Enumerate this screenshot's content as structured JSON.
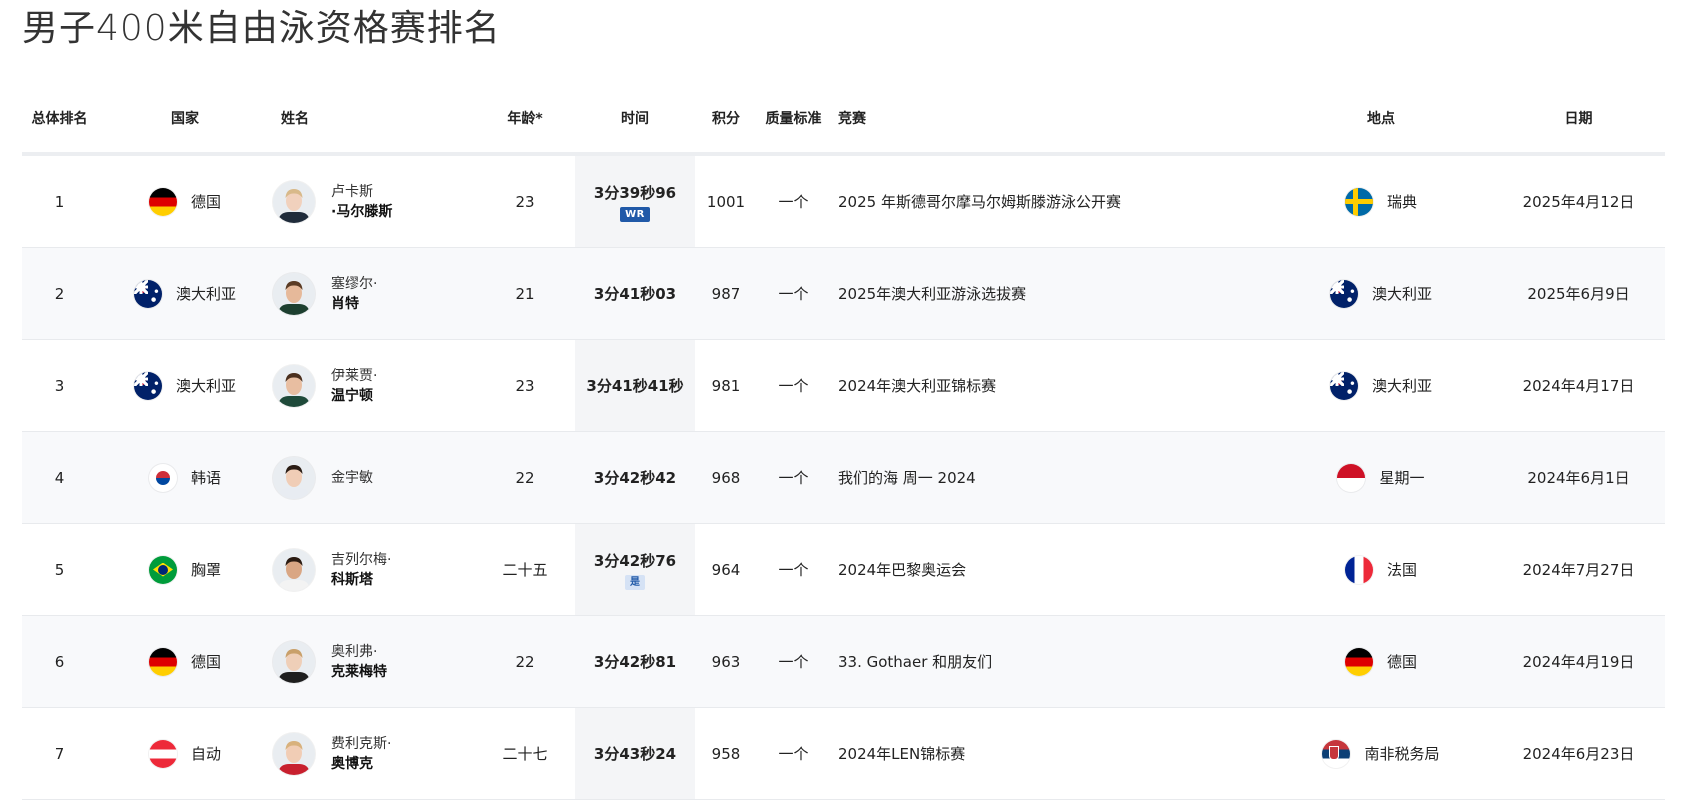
{
  "page_title": "男子400米自由泳资格赛排名",
  "columns": {
    "rank": "总体排名",
    "country": "国家",
    "name": "姓名",
    "age": "年龄*",
    "time": "时间",
    "points": "积分",
    "standard": "质量标准",
    "competition": "竞赛",
    "venue": "地点",
    "date": "日期"
  },
  "rows": [
    {
      "rank": "1",
      "country": "德国",
      "flag": "germany-flag-icon",
      "first_name": "卢卡斯",
      "last_name": "·马尔滕斯",
      "age": "23",
      "time": "3分39秒96",
      "badge": "WR",
      "points": "1001",
      "standard": "一个",
      "competition": "2025 年斯德哥尔摩马尔姆斯滕游泳公开赛",
      "venue": "瑞典",
      "venue_flag": "sweden-flag-icon",
      "date": "2025年4月12日"
    },
    {
      "rank": "2",
      "country": "澳大利亚",
      "flag": "australia-flag-icon",
      "first_name": "塞缪尔·",
      "last_name": "肖特",
      "age": "21",
      "time": "3分41秒03",
      "badge": "",
      "points": "987",
      "standard": "一个",
      "competition": "2025年澳大利亚游泳选拔赛",
      "venue": "澳大利亚",
      "venue_flag": "australia-flag-icon",
      "date": "2025年6月9日"
    },
    {
      "rank": "3",
      "country": "澳大利亚",
      "flag": "australia-flag-icon",
      "first_name": "伊莱贾·",
      "last_name": "温宁顿",
      "age": "23",
      "time": "3分41秒41秒",
      "badge": "",
      "points": "981",
      "standard": "一个",
      "competition": "2024年澳大利亚锦标赛",
      "venue": "澳大利亚",
      "venue_flag": "australia-flag-icon",
      "date": "2024年4月17日"
    },
    {
      "rank": "4",
      "country": "韩语",
      "flag": "korea-flag-icon",
      "first_name": "金宇敏",
      "last_name": "",
      "age": "22",
      "time": "3分42秒42",
      "badge": "",
      "points": "968",
      "standard": "一个",
      "competition": "我们的海 周一 2024",
      "venue": "星期一",
      "venue_flag": "indonesia-flag-icon",
      "date": "2024年6月1日"
    },
    {
      "rank": "5",
      "country": "胸罩",
      "flag": "brazil-flag-icon",
      "first_name": "吉列尔梅·",
      "last_name": "科斯塔",
      "age": "二十五",
      "time": "3分42秒76",
      "badge": "是",
      "points": "964",
      "standard": "一个",
      "competition": "2024年巴黎奥运会",
      "venue": "法国",
      "venue_flag": "france-flag-icon",
      "date": "2024年7月27日"
    },
    {
      "rank": "6",
      "country": "德国",
      "flag": "germany-flag-icon",
      "first_name": "奥利弗·",
      "last_name": "克莱梅特",
      "age": "22",
      "time": "3分42秒81",
      "badge": "",
      "points": "963",
      "standard": "一个",
      "competition": "33. Gothaer 和朋友们",
      "venue": "德国",
      "venue_flag": "germany-flag-icon",
      "date": "2024年4月19日"
    },
    {
      "rank": "7",
      "country": "自动",
      "flag": "austria-flag-icon",
      "first_name": "费利克斯·",
      "last_name": "奥博克",
      "age": "二十七",
      "time": "3分43秒24",
      "badge": "",
      "points": "958",
      "standard": "一个",
      "competition": "2024年LEN锦标赛",
      "venue": "南非税务局",
      "venue_flag": "serbia-flag-icon",
      "date": "2024年6月23日"
    }
  ]
}
